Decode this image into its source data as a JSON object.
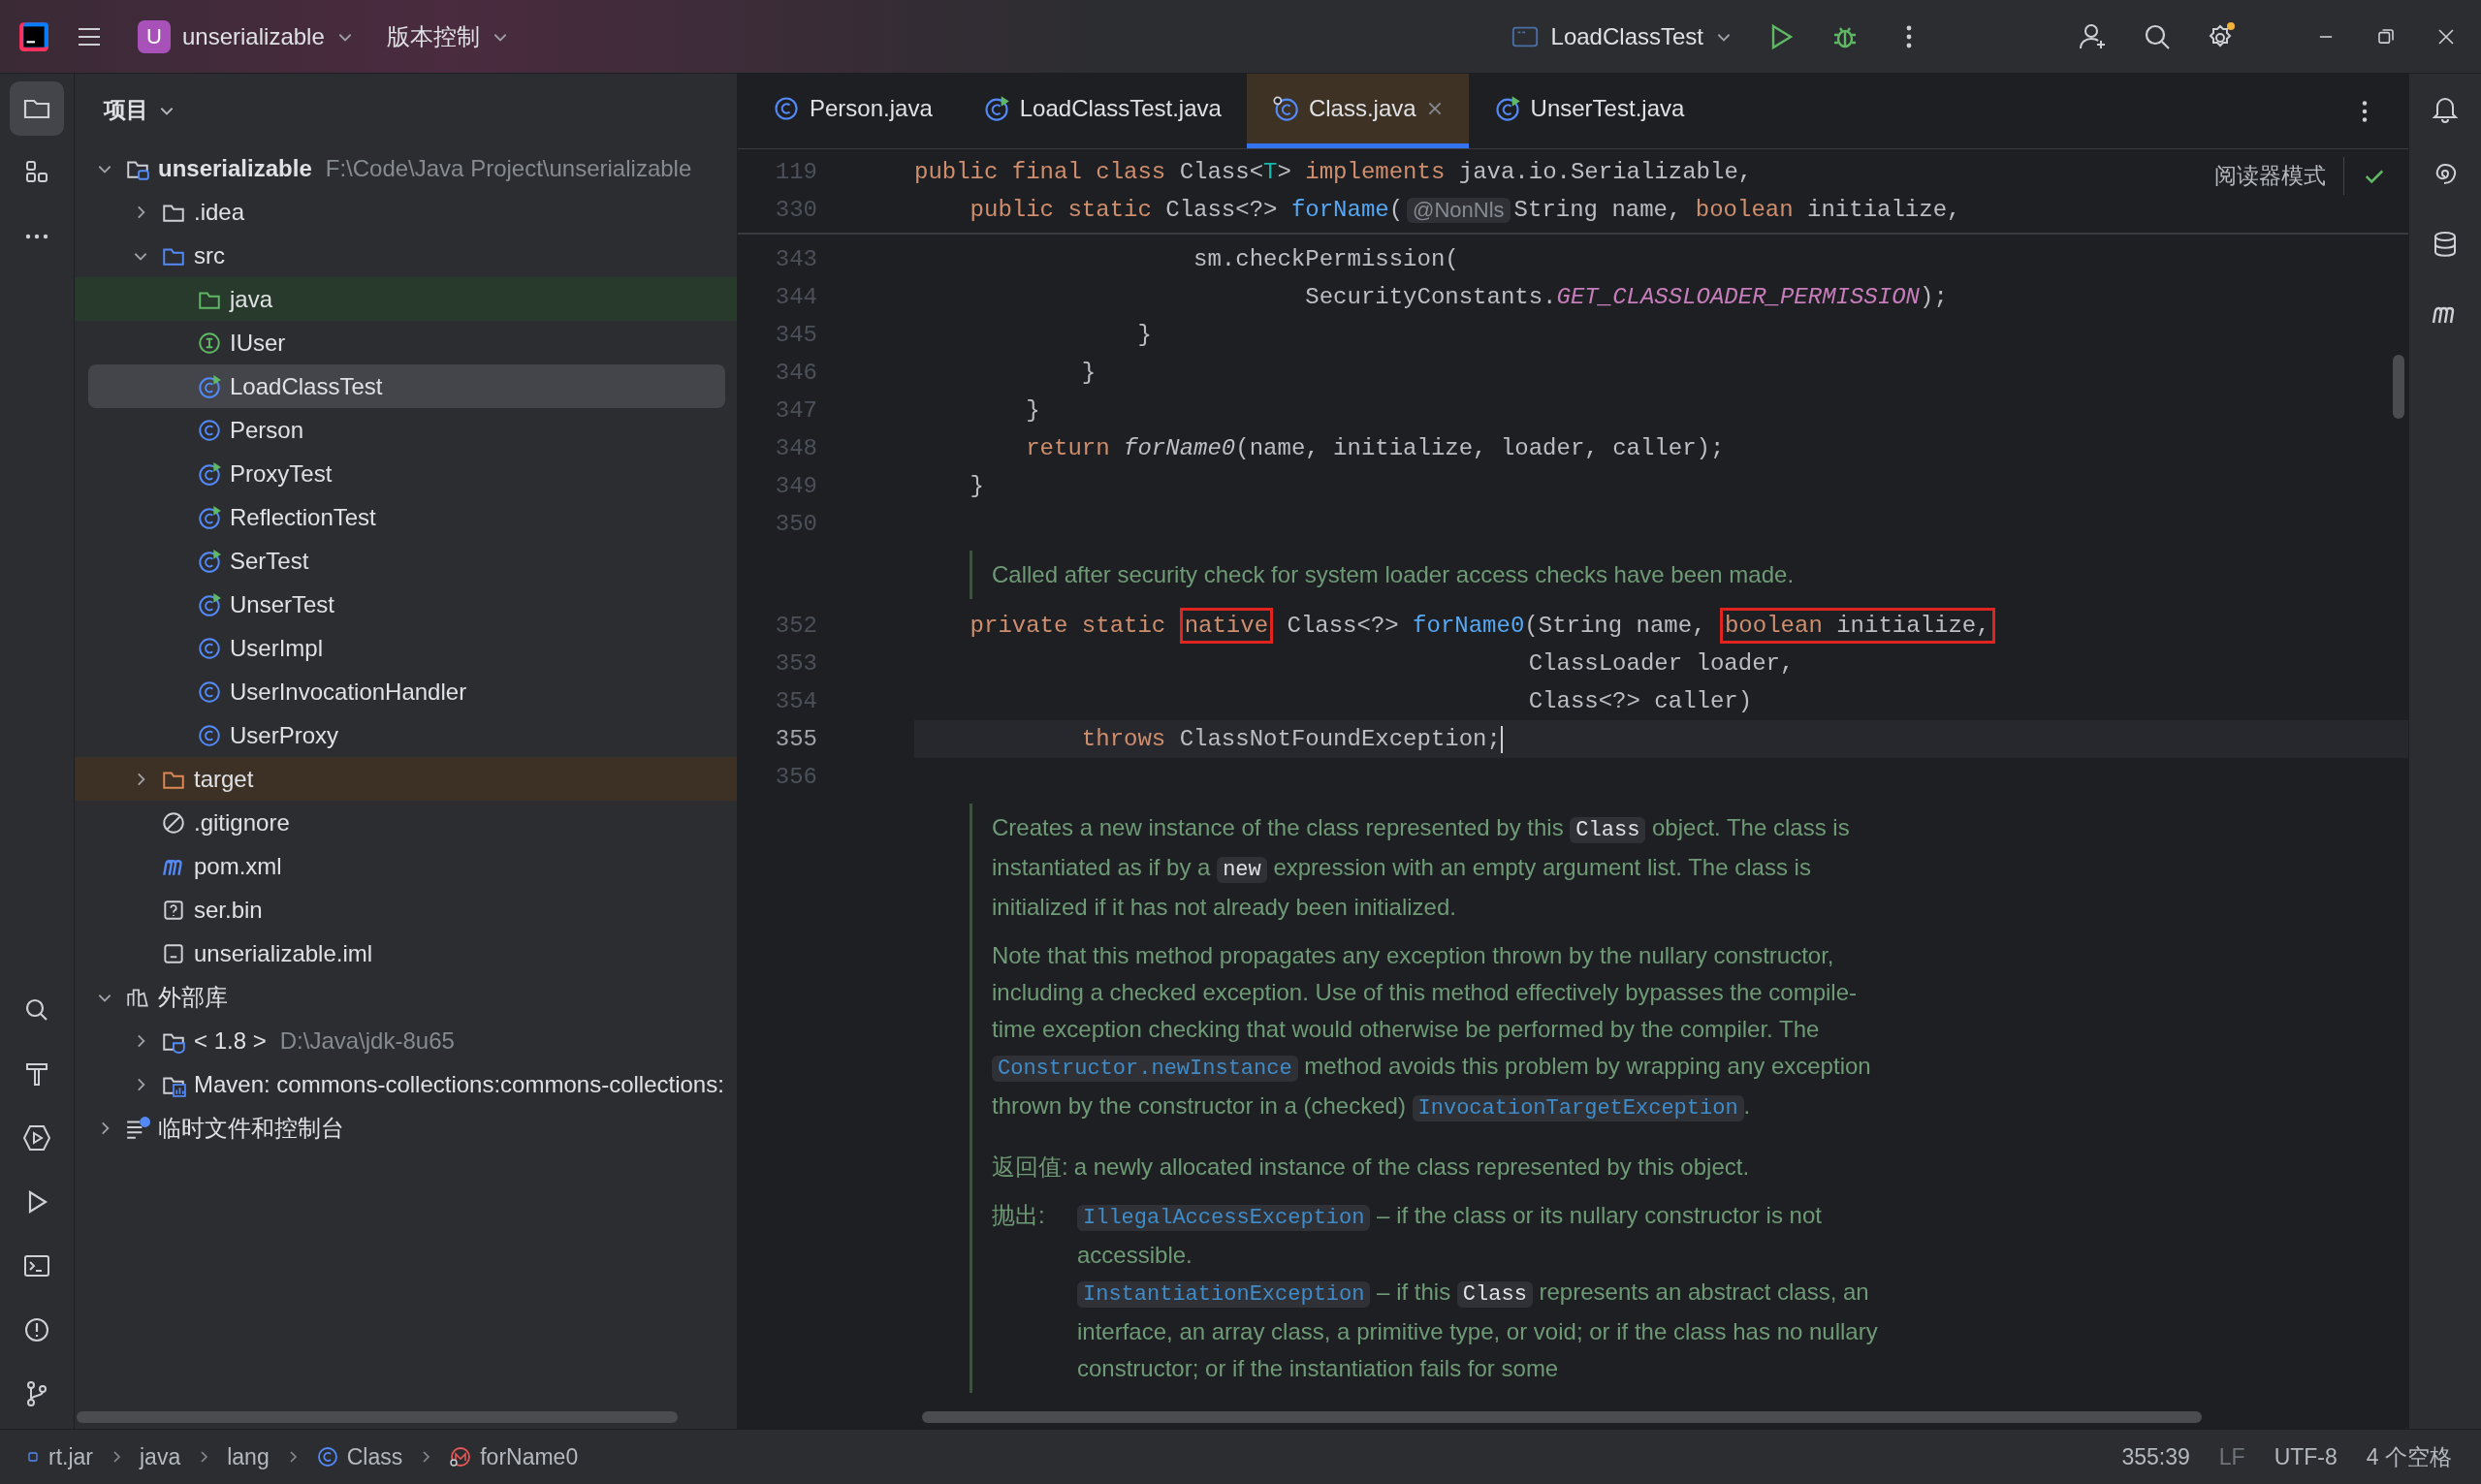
{
  "title_bar": {
    "project_badge": "U",
    "project": "unserializable",
    "vcs": "版本控制",
    "run_config": "LoadClassTest"
  },
  "left_toolbar": [
    {
      "selected": true
    },
    {
      "selected": false
    },
    {
      "selected": false
    },
    {
      "selected": false
    },
    {
      "selected": false
    },
    {
      "selected": false
    },
    {
      "selected": false
    },
    {
      "selected": false
    },
    {
      "selected": false
    },
    {
      "selected": false
    }
  ],
  "project": {
    "title": "项目",
    "tree": [
      {
        "label": "unserializable",
        "kind": "module",
        "hint": "F:\\Code\\Java Project\\unserializable",
        "expanded": true,
        "selected": false,
        "children": [
          {
            "label": ".idea",
            "kind": "folder",
            "expanded": false,
            "selected": false
          },
          {
            "label": "src",
            "kind": "source-folder",
            "expanded": true,
            "selected": false,
            "children": [
              {
                "label": "java",
                "kind": "java-folder",
                "selected": false,
                "color": "#283a2c"
              },
              {
                "label": "IUser",
                "kind": "interface",
                "selected": false
              },
              {
                "label": "LoadClassTest",
                "kind": "runnable-class",
                "selected": true
              },
              {
                "label": "Person",
                "kind": "class",
                "selected": false
              },
              {
                "label": "ProxyTest",
                "kind": "runnable-class",
                "selected": false
              },
              {
                "label": "ReflectionTest",
                "kind": "runnable-class",
                "selected": false
              },
              {
                "label": "SerTest",
                "kind": "runnable-class",
                "selected": false
              },
              {
                "label": "UnserTest",
                "kind": "runnable-class",
                "selected": false
              },
              {
                "label": "UserImpl",
                "kind": "class",
                "selected": false
              },
              {
                "label": "UserInvocationHandler",
                "kind": "class",
                "selected": false
              },
              {
                "label": "UserProxy",
                "kind": "class",
                "selected": false
              }
            ]
          },
          {
            "label": "target",
            "kind": "excluded-folder",
            "expanded": false,
            "selected": false,
            "color": "#3d3125"
          },
          {
            "label": ".gitignore",
            "kind": "ignore",
            "selected": false
          },
          {
            "label": "pom.xml",
            "kind": "maven",
            "selected": false
          },
          {
            "label": "ser.bin",
            "kind": "unknown",
            "selected": false
          },
          {
            "label": "unserializable.iml",
            "kind": "iml",
            "selected": false
          }
        ]
      },
      {
        "label": "外部库",
        "kind": "library",
        "expanded": true,
        "selected": false,
        "children": [
          {
            "label": "< 1.8 >",
            "kind": "jdk",
            "hint": "D:\\Java\\jdk-8u65",
            "expanded": false,
            "selected": false
          },
          {
            "label": "Maven: commons-collections:commons-collections:",
            "kind": "maven-library",
            "expanded": false,
            "selected": false
          }
        ]
      },
      {
        "label": "临时文件和控制台",
        "kind": "scratches",
        "expanded": false,
        "selected": false
      }
    ]
  },
  "tabs": [
    {
      "label": "Person.java",
      "kind": "class",
      "selected": false
    },
    {
      "label": "LoadClassTest.java",
      "kind": "runnable-class",
      "selected": false
    },
    {
      "label": "Class.java",
      "kind": "library-class",
      "selected": true
    },
    {
      "label": "UnserTest.java",
      "kind": "runnable-class",
      "selected": false
    }
  ],
  "editor": {
    "reader_mode": "阅读器模式",
    "sticky": [
      {
        "number": "119",
        "tokens": [
          {
            "text": "public final class ",
            "kind": "keyword"
          },
          {
            "text": "Class<",
            "kind": "plain"
          },
          {
            "text": "T",
            "kind": "generic"
          },
          {
            "text": "> ",
            "kind": "plain"
          },
          {
            "text": "implements",
            "kind": "keyword"
          },
          {
            "text": " java.io.Serializable,",
            "kind": "plain"
          }
        ]
      },
      {
        "number": "330",
        "tokens": [
          {
            "text": "    public static ",
            "kind": "keyword"
          },
          {
            "text": "Class<?> ",
            "kind": "plain"
          },
          {
            "text": "forName",
            "kind": "declaration"
          },
          {
            "text": "(",
            "kind": "plain"
          },
          {
            "text": "@NonNls",
            "kind": "annotation"
          },
          {
            "text": "String name, ",
            "kind": "plain"
          },
          {
            "text": "boolean",
            "kind": "keyword"
          },
          {
            "text": " initialize,",
            "kind": "plain"
          }
        ]
      }
    ],
    "lines": [
      {
        "kind": "code",
        "number": "343",
        "current": false,
        "tokens": [
          {
            "text": "                    sm.checkPermission(",
            "kind": "plain"
          }
        ]
      },
      {
        "kind": "code",
        "number": "344",
        "current": false,
        "tokens": [
          {
            "text": "                            SecurityConstants.",
            "kind": "plain"
          },
          {
            "text": "GET_CLASSLOADER_PERMISSION",
            "kind": "constant"
          },
          {
            "text": ");",
            "kind": "plain"
          }
        ]
      },
      {
        "kind": "code",
        "number": "345",
        "current": false,
        "tokens": [
          {
            "text": "                }",
            "kind": "plain"
          }
        ]
      },
      {
        "kind": "code",
        "number": "346",
        "current": false,
        "tokens": [
          {
            "text": "            }",
            "kind": "plain"
          }
        ]
      },
      {
        "kind": "code",
        "number": "347",
        "current": false,
        "tokens": [
          {
            "text": "        }",
            "kind": "plain"
          }
        ]
      },
      {
        "kind": "code",
        "number": "348",
        "current": false,
        "tokens": [
          {
            "text": "        return ",
            "kind": "keyword"
          },
          {
            "text": "forName0",
            "kind": "call"
          },
          {
            "text": "(name, initialize, loader, caller);",
            "kind": "plain"
          }
        ]
      },
      {
        "kind": "code",
        "number": "349",
        "current": false,
        "tokens": [
          {
            "text": "    }",
            "kind": "plain"
          }
        ]
      },
      {
        "kind": "code",
        "number": "350",
        "current": false
      },
      {
        "kind": "doc",
        "paragraphs": [
          {
            "runs": [
              {
                "text": "Called after security check for system loader access checks have been made.",
                "kind": "text"
              }
            ]
          }
        ]
      },
      {
        "kind": "code",
        "number": "352",
        "current": false,
        "tokens": [
          {
            "text": "    private static ",
            "kind": "keyword"
          },
          {
            "kind": "box",
            "tokens": [
              {
                "text": "native",
                "kind": "keyword"
              }
            ]
          },
          {
            "text": " Class<?> ",
            "kind": "plain"
          },
          {
            "text": "forName0",
            "kind": "declaration"
          },
          {
            "text": "(String name, ",
            "kind": "plain"
          },
          {
            "kind": "box",
            "tokens": [
              {
                "text": "boolean",
                "kind": "keyword"
              },
              {
                "text": " initialize,",
                "kind": "plain"
              }
            ]
          }
        ]
      },
      {
        "kind": "code",
        "number": "353",
        "current": false,
        "tokens": [
          {
            "text": "                                            ClassLoader loader,",
            "kind": "plain"
          }
        ]
      },
      {
        "kind": "code",
        "number": "354",
        "current": false,
        "tokens": [
          {
            "text": "                                            Class<?> caller)",
            "kind": "plain"
          }
        ]
      },
      {
        "kind": "code",
        "number": "355",
        "current": true,
        "tokens": [
          {
            "text": "            throws ",
            "kind": "keyword"
          },
          {
            "text": "ClassNotFoundException;",
            "kind": "plain"
          }
        ]
      },
      {
        "kind": "code",
        "number": "356",
        "current": false
      },
      {
        "kind": "doc",
        "paragraphs": [
          {
            "runs": [
              {
                "text": "Creates a new instance of the class represented by this ",
                "kind": "text"
              },
              {
                "text": "Class",
                "kind": "code"
              },
              {
                "text": " object. The class is instantiated as if by a ",
                "kind": "text"
              },
              {
                "text": "new",
                "kind": "code"
              },
              {
                "text": " expression with an empty argument list. The class is initialized if it has not already been initialized.",
                "kind": "text"
              }
            ]
          },
          {
            "runs": [
              {
                "text": "Note that this method propagates any exception thrown by the nullary constructor, including a checked exception. Use of this method effectively bypasses the compile-time exception checking that would otherwise be performed by the compiler. The ",
                "kind": "text"
              },
              {
                "text": "Constructor.newInstance",
                "kind": "link"
              },
              {
                "text": " method avoids this problem by wrapping any exception thrown by the constructor in a (checked) ",
                "kind": "text"
              },
              {
                "text": "InvocationTargetException",
                "kind": "link"
              },
              {
                "text": ".",
                "kind": "text"
              }
            ]
          }
        ],
        "returns": {
          "label": "返回值:",
          "text": "a newly allocated instance of the class represented by this object."
        },
        "throws": {
          "label": "抛出:",
          "items": [
            {
              "runs": [
                {
                  "text": "IllegalAccessException",
                  "kind": "link"
                },
                {
                  "text": " – if the class or its nullary constructor is not accessible.",
                  "kind": "text"
                }
              ]
            },
            {
              "runs": [
                {
                  "text": "InstantiationException",
                  "kind": "link"
                },
                {
                  "text": " – if this ",
                  "kind": "text"
                },
                {
                  "text": "Class",
                  "kind": "code"
                },
                {
                  "text": " represents an abstract class, an interface, an array class, a primitive type, or void; or if the class has no nullary constructor; or if the instantiation fails for some",
                  "kind": "text"
                }
              ]
            }
          ]
        }
      }
    ]
  },
  "status_bar": {
    "breadcrumbs": [
      {
        "text": "rt.jar",
        "kind": "jar"
      },
      {
        "text": "java",
        "kind": "package"
      },
      {
        "text": "lang",
        "kind": "package"
      },
      {
        "text": "Class",
        "kind": "class"
      },
      {
        "text": "forName0",
        "kind": "method"
      }
    ],
    "position": "355:39",
    "line_separator": "LF",
    "encoding": "UTF-8",
    "indent": "4 个空格"
  }
}
